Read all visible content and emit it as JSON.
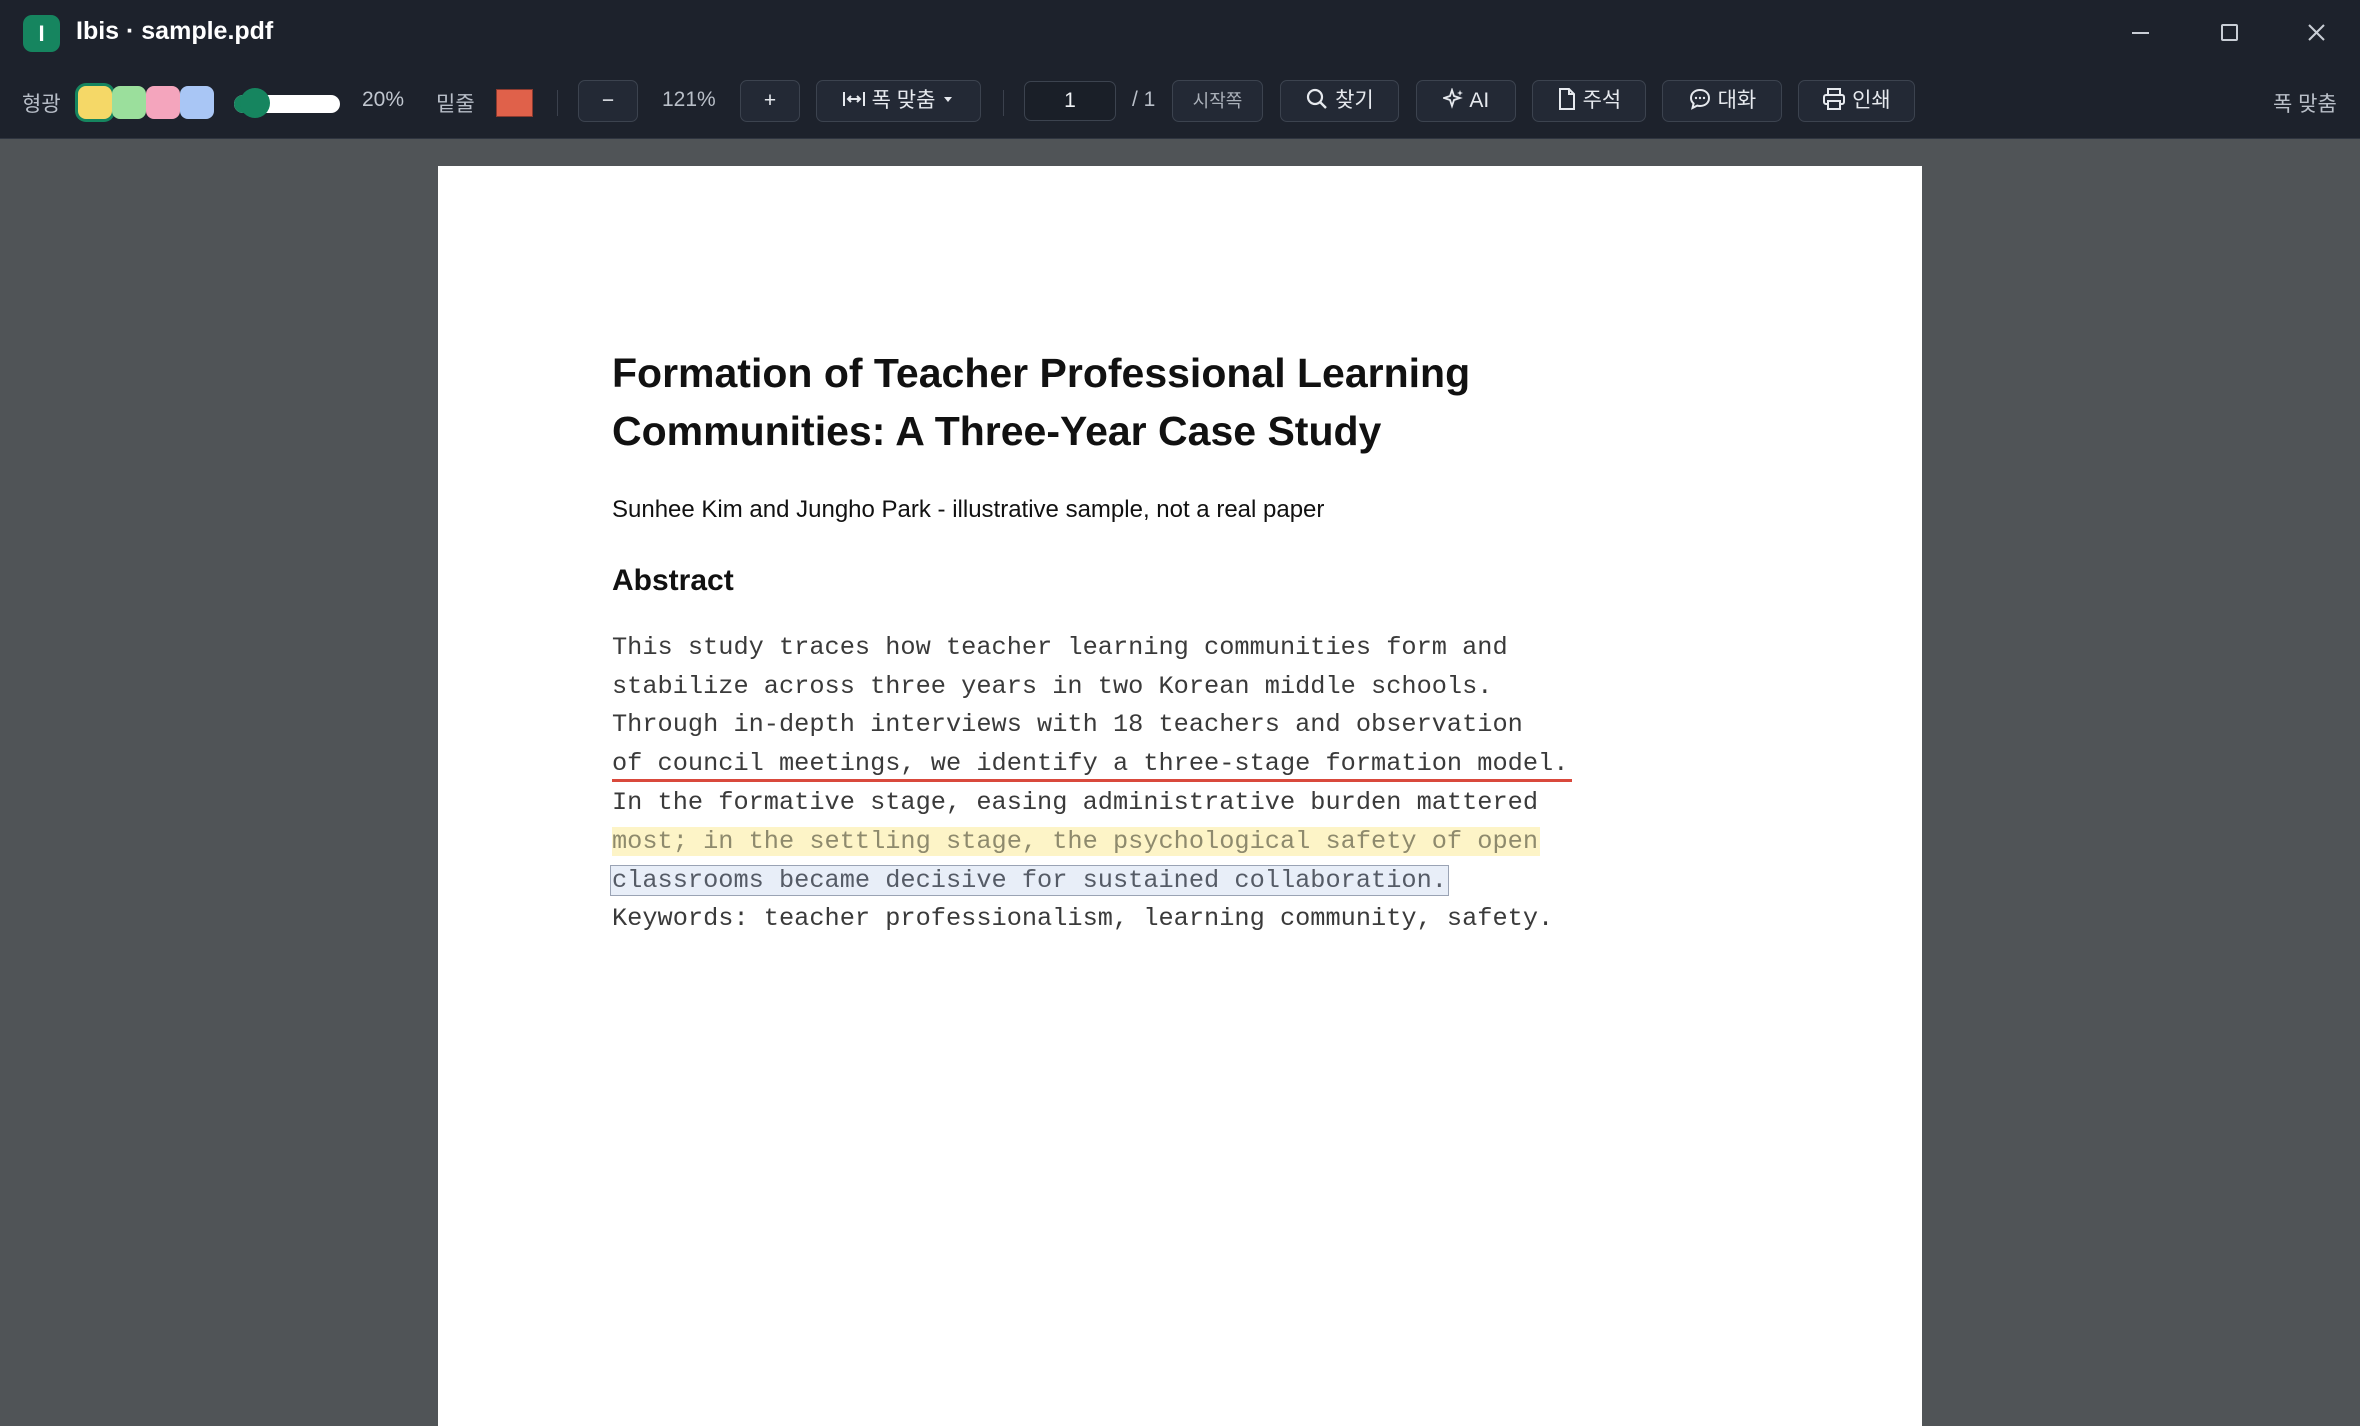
{
  "window": {
    "app_initial": "I",
    "title": "Ibis · sample.pdf"
  },
  "toolbar": {
    "highlight_label": "형광",
    "highlight_colors": [
      "#f5d867",
      "#9bdf9c",
      "#f4a5bd",
      "#a9c6f5"
    ],
    "selected_color": "#f5d867",
    "opacity": 0.2,
    "opacity_label": "20%",
    "underline_label": "밑줄",
    "underline_color": "#e0614a",
    "zoom_out_label": "−",
    "zoom_value": "121%",
    "zoom_in_label": "+",
    "fit_label": "폭 맞춤",
    "page_current": "1",
    "page_total": "/ 1",
    "start_page_label": "시작쪽",
    "find_label": "찾기",
    "ai_label": "AI",
    "annotation_label": "주석",
    "chat_label": "대화",
    "print_label": "인쇄",
    "fit_right_label": "폭 맞춤"
  },
  "document": {
    "title": "Formation of Teacher Professional Learning Communities: A Three-Year Case Study",
    "authors": "Sunhee Kim and Jungho Park - illustrative sample, not a real paper",
    "abstract_heading": "Abstract",
    "abstract_lines": [
      "This study traces how teacher learning communities form and",
      "stabilize across three years in two Korean middle schools.",
      "Through in-depth interviews with 18 teachers and observation",
      "of council meetings, we identify a three-stage formation model.",
      "In the formative stage, easing administrative burden mattered",
      "most; in the settling stage, the psychological safety of open",
      "classrooms became decisive for sustained collaboration.",
      "Keywords: teacher professionalism, learning community, safety."
    ]
  }
}
